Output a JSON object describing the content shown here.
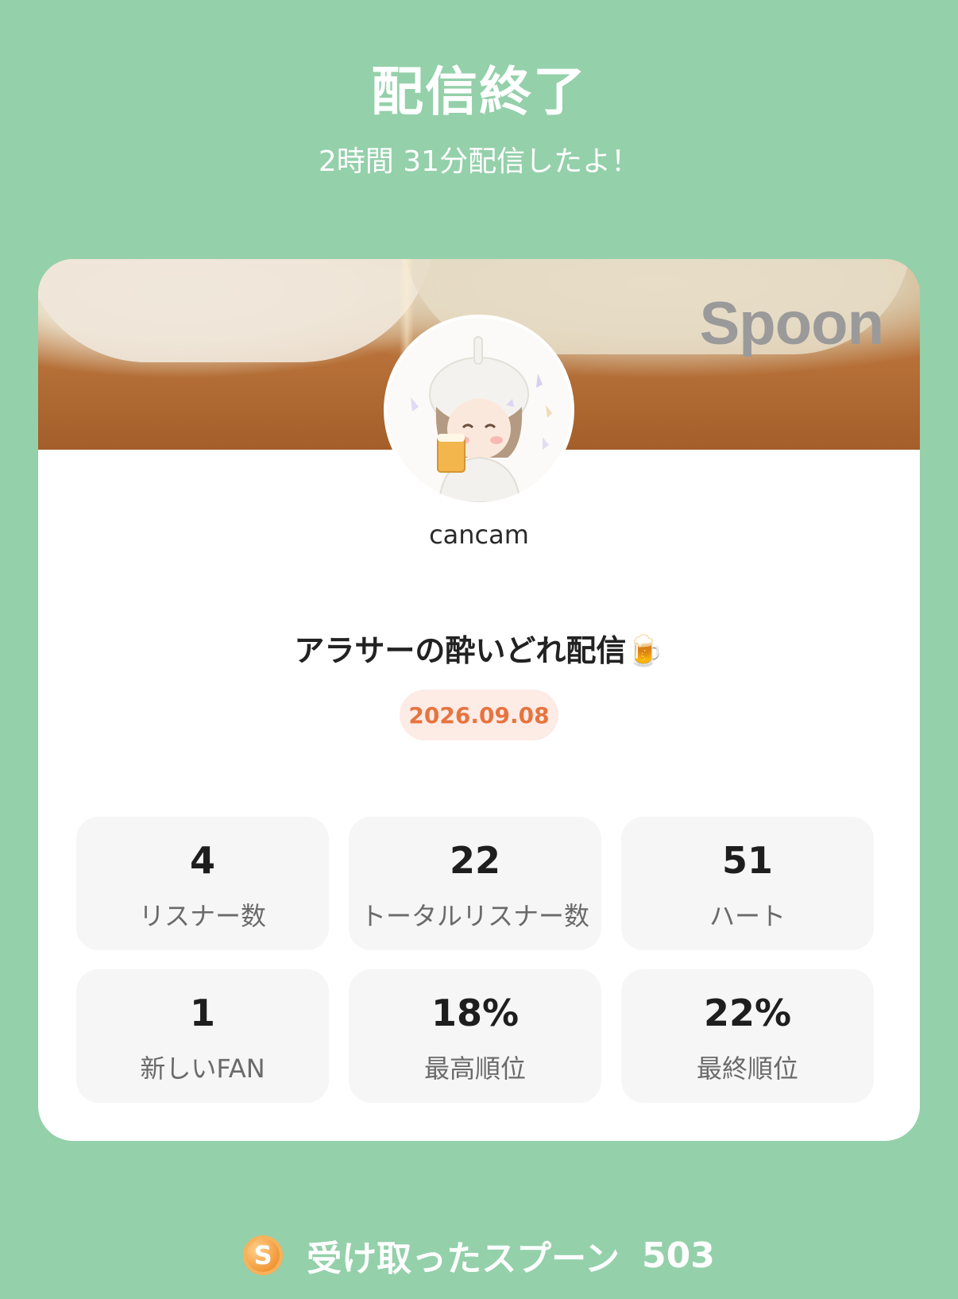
{
  "header": {
    "title": "配信終了",
    "subtitle": "2時間 31分配信したよ！"
  },
  "card": {
    "brand": "Spoon",
    "username": "cancam",
    "stream_title": "アラサーの酔いどれ配信🍺",
    "date": "2026.09.08"
  },
  "stats": [
    {
      "value": "4",
      "label": "リスナー数"
    },
    {
      "value": "22",
      "label": "トータルリスナー数"
    },
    {
      "value": "51",
      "label": "ハート"
    },
    {
      "value": "1",
      "label": "新しいFAN"
    },
    {
      "value": "18%",
      "label": "最高順位"
    },
    {
      "value": "22%",
      "label": "最終順位"
    }
  ],
  "footer": {
    "coin_symbol": "S",
    "label": "受け取ったスプーン",
    "count": "503"
  },
  "colors": {
    "background": "#94d0aa",
    "card": "#ffffff",
    "date_text": "#e6743f",
    "date_bg": "#fdebe6",
    "stat_bg": "#f6f6f6"
  }
}
